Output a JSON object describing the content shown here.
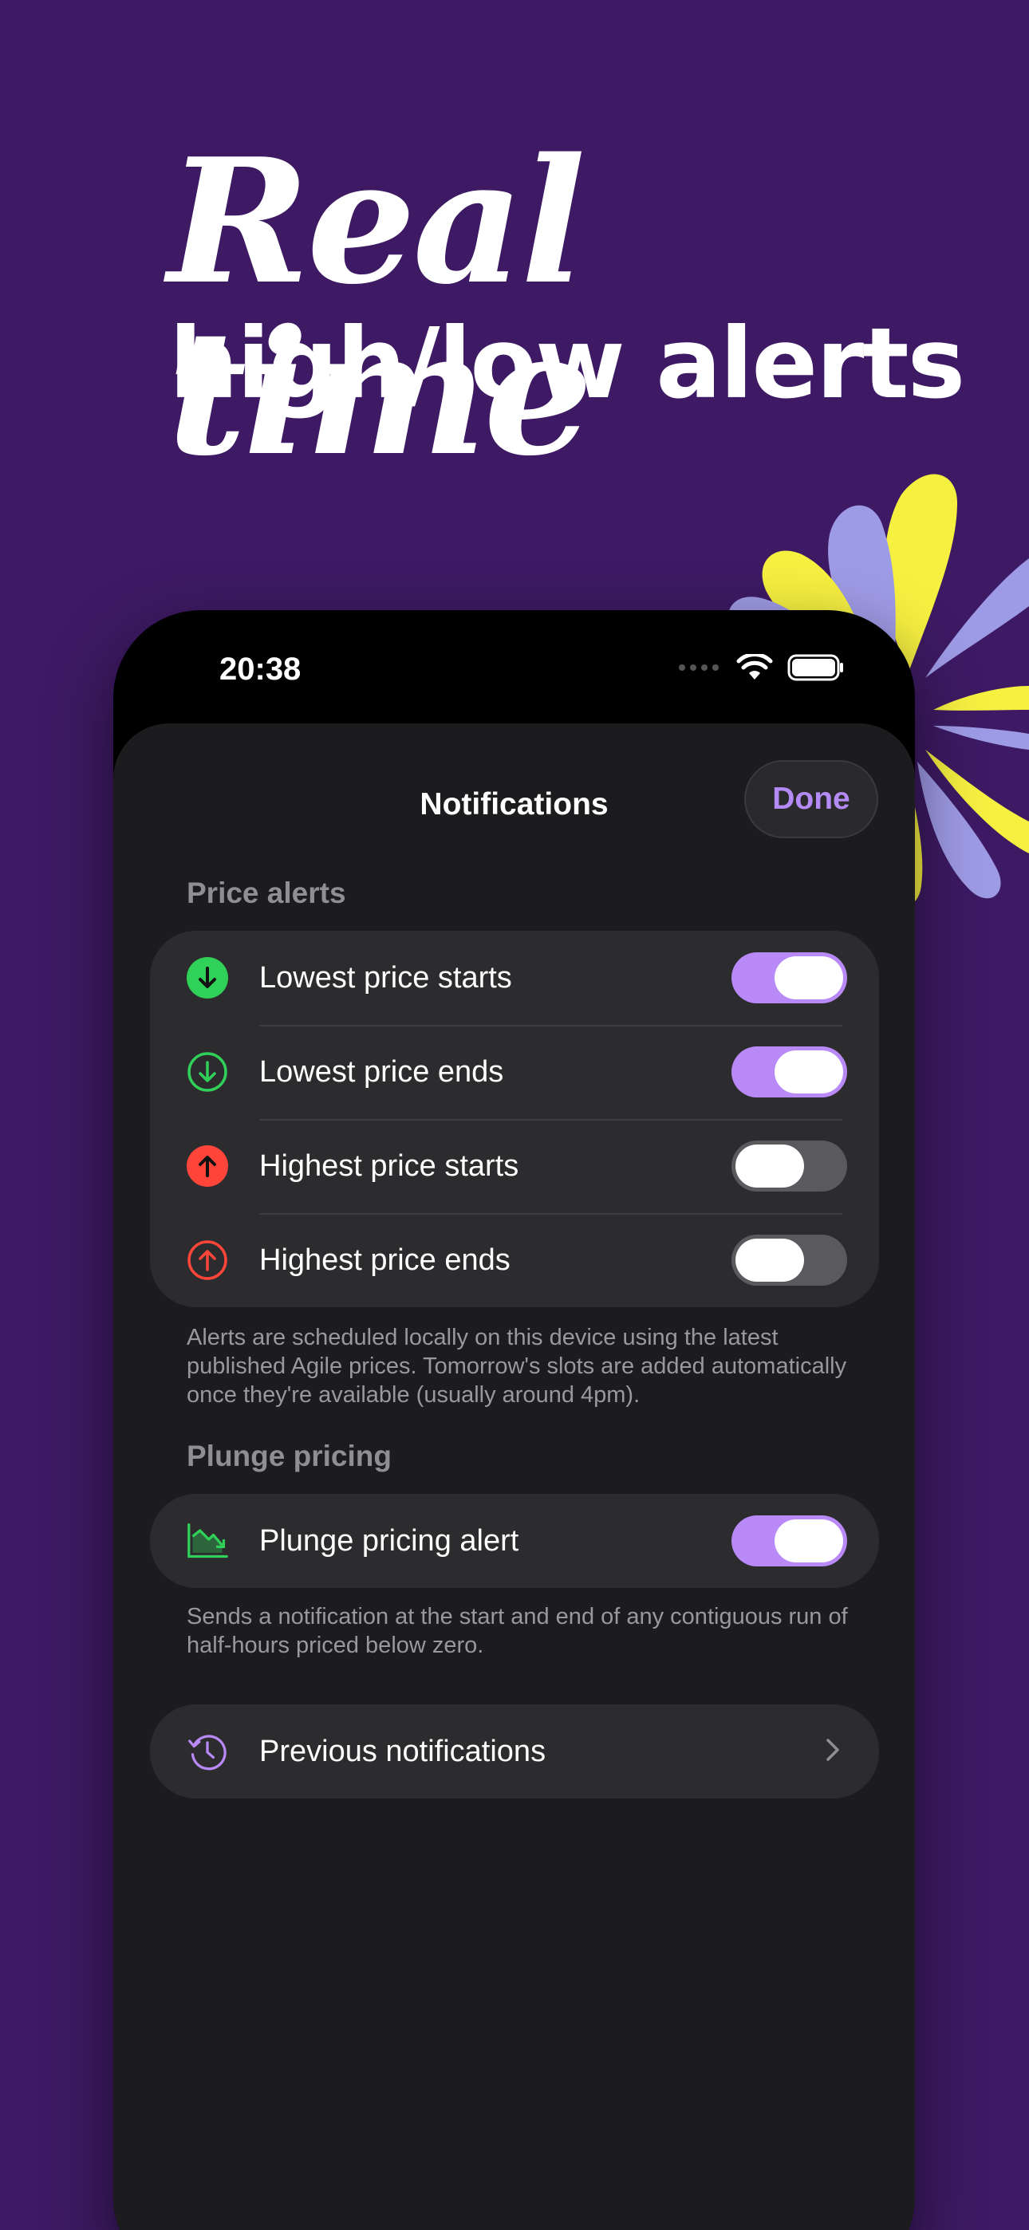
{
  "hero": {
    "title_script": "Real time",
    "title_sub": "high/low alerts"
  },
  "status_bar": {
    "time": "20:38"
  },
  "sheet": {
    "title": "Notifications",
    "done_label": "Done"
  },
  "price_alerts": {
    "header": "Price alerts",
    "rows": [
      {
        "label": "Lowest price starts",
        "icon": "arrow-down-filled-circle-icon",
        "enabled": true
      },
      {
        "label": "Lowest price ends",
        "icon": "arrow-down-outline-circle-icon",
        "enabled": true
      },
      {
        "label": "Highest price starts",
        "icon": "arrow-up-filled-circle-icon",
        "enabled": false
      },
      {
        "label": "Highest price ends",
        "icon": "arrow-up-outline-circle-icon",
        "enabled": false
      }
    ],
    "footer": "Alerts are scheduled locally on this device using the latest published Agile prices. Tomorrow's slots are added automatically once they're available (usually around 4pm)."
  },
  "plunge_pricing": {
    "header": "Plunge pricing",
    "row": {
      "label": "Plunge pricing alert",
      "icon": "chart-down-icon",
      "enabled": true
    },
    "footer": "Sends a notification at the start and end of any contiguous run of half-hours priced below zero."
  },
  "previous": {
    "label": "Previous notifications",
    "icon": "history-clock-icon"
  },
  "colors": {
    "background": "#3d1a63",
    "accent": "#b98af7",
    "green": "#30d158",
    "red": "#ff453a"
  }
}
